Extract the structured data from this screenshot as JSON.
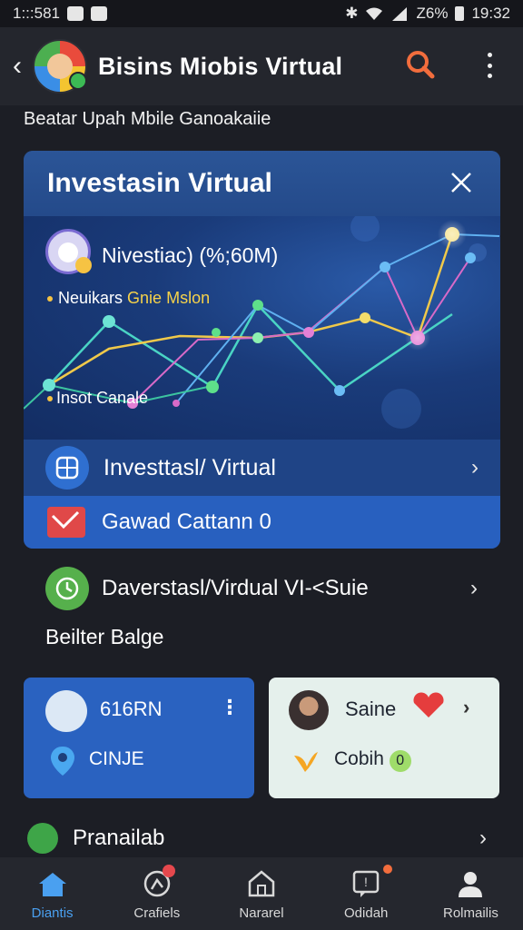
{
  "status_bar": {
    "time_left": "1:::581",
    "battery": "Z6%",
    "time_right": "19:32"
  },
  "app_bar": {
    "title": "Bisins Miobis Virtual"
  },
  "subtitle": "Beatar Upah Mbile Ganoakaiie",
  "card": {
    "title": "Investasin Virtual",
    "ai_label": "Nivestiac) (%;60M)",
    "legend_prefix": "Neuikars",
    "legend_highlight": "Gnie Mslon",
    "legend_bottom": "Insot Canale",
    "row1_label": "Investtasl/ Virtual",
    "row2_label": "Gawad Cattann",
    "row2_suffix": "0"
  },
  "invest_row": {
    "label": "Daverstasl/Virdual VI-<Suie"
  },
  "section_title": "Beilter Balge",
  "tiles": {
    "a": {
      "title": "616RN",
      "subtitle": "CINJE"
    },
    "b": {
      "title": "Saine",
      "subtitle": "Cobih",
      "subtitle_badge": "0"
    }
  },
  "pr_row": {
    "label": "Pranailab"
  },
  "bottom_nav": [
    {
      "label": "Diantis",
      "active": true
    },
    {
      "label": "Crafiels"
    },
    {
      "label": "Nararel"
    },
    {
      "label": "Odidah"
    },
    {
      "label": "Rolmailis"
    }
  ],
  "colors": {
    "accent": "#2a62c0",
    "search_icon": "#f26d3d",
    "nav_active": "#4aa0f0"
  }
}
